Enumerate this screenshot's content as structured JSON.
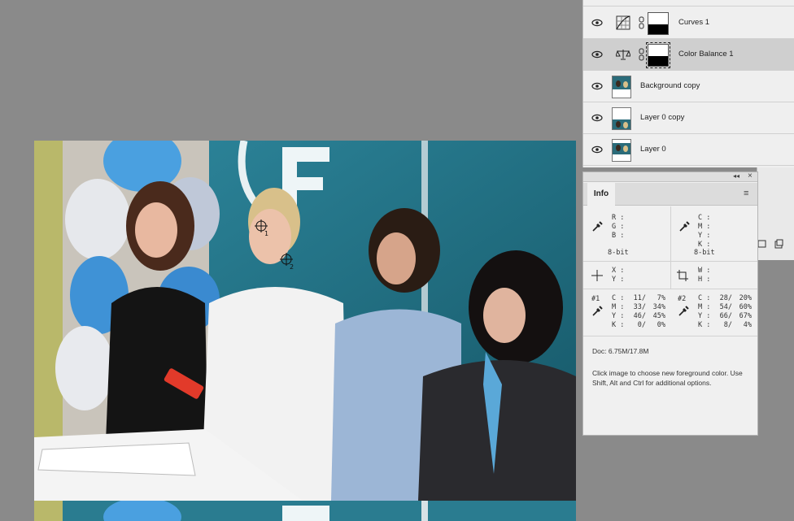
{
  "layers": [
    {
      "name": "Curves 1",
      "type": "adjustment",
      "icon": "curves-icon",
      "selected": false
    },
    {
      "name": "Color Balance 1",
      "type": "adjustment",
      "icon": "color-balance-icon",
      "selected": true
    },
    {
      "name": "Background copy",
      "type": "pixel",
      "selected": false
    },
    {
      "name": "Layer 0 copy",
      "type": "pixel",
      "selected": false
    },
    {
      "name": "Layer 0",
      "type": "pixel",
      "selected": false
    }
  ],
  "info": {
    "tab": "Info",
    "rgb": {
      "labels": [
        "R :",
        "G :",
        "B :"
      ],
      "mode": "8-bit"
    },
    "cmyk": {
      "labels": [
        "C :",
        "M :",
        "Y :",
        "K :"
      ],
      "mode": "8-bit"
    },
    "xy": {
      "labels": [
        "X :",
        "Y :"
      ]
    },
    "wh": {
      "labels": [
        "W :",
        "H :"
      ]
    },
    "sample1": {
      "id": "#1",
      "rows": [
        {
          "ch": "C :",
          "v1": "11/",
          "v2": "7%"
        },
        {
          "ch": "M :",
          "v1": "33/",
          "v2": "34%"
        },
        {
          "ch": "Y :",
          "v1": "46/",
          "v2": "45%"
        },
        {
          "ch": "K :",
          "v1": "0/",
          "v2": "0%"
        }
      ]
    },
    "sample2": {
      "id": "#2",
      "rows": [
        {
          "ch": "C :",
          "v1": "28/",
          "v2": "20%"
        },
        {
          "ch": "M :",
          "v1": "54/",
          "v2": "60%"
        },
        {
          "ch": "Y :",
          "v1": "66/",
          "v2": "67%"
        },
        {
          "ch": "K :",
          "v1": "8/",
          "v2": "4%"
        }
      ]
    },
    "doc": "Doc: 6.75M/17.8M",
    "help": "Click image to choose new foreground color.  Use Shift, Alt and Ctrl for additional options."
  },
  "canvas": {
    "samplers": [
      "1",
      "2"
    ]
  }
}
